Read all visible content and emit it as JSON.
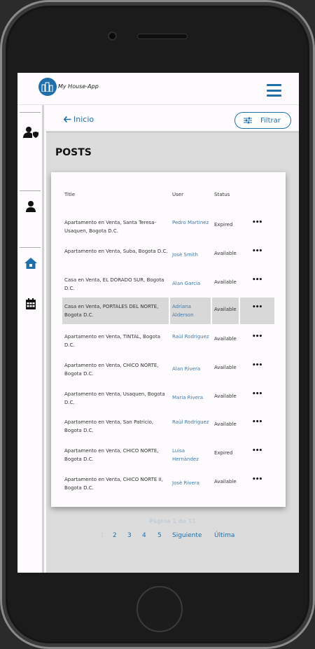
{
  "app": {
    "name": "My House-App"
  },
  "nav": {
    "back_label": "Inicio",
    "filter_label": "Filtrar"
  },
  "page": {
    "title": "POSTS"
  },
  "table": {
    "headers": {
      "title": "Title",
      "user": "User",
      "status": "Status"
    },
    "rows": [
      {
        "title": "Apartamento en Venta, Santa Teresa-Usaquen, Bogota D.C.",
        "user": "Pedro Martinez",
        "status": "Expired",
        "more": "•••"
      },
      {
        "title": "Apartamento en Venta, Suba, Bogota D.C.",
        "user": "Josè Smith",
        "status": "Available",
        "more": "•••"
      },
      {
        "title": "Casa en Venta, EL DORADO SUR, Bogota D.C.",
        "user": "Alan Garcia",
        "status": "Available",
        "more": "•••"
      },
      {
        "title": "Casa en Venta, PORTALES DEL NORTE, Bogota D.C.",
        "user": "Adriana Alderson",
        "status": "Available",
        "more": "•••"
      },
      {
        "title": "Apartamento en Venta, TINTAL, Bogota D.C.",
        "user": "Raùl Rodriguez",
        "status": "Available",
        "more": "•••"
      },
      {
        "title": "Apartamento en Venta, CHICO NORTE, Bogota D.C.",
        "user": "Alan Rivera",
        "status": "Available",
        "more": "•••"
      },
      {
        "title": "Apartamento en Venta, Usaquen, Bogota D.C.",
        "user": "Maria Rivera",
        "status": "Available",
        "more": "•••"
      },
      {
        "title": "Apartamento en Venta, San Patricio, Bogota D.C.",
        "user": "Raùl Rodriguez",
        "status": "Available",
        "more": "•••"
      },
      {
        "title": "Apartamento en Venta, CHICO NORTE, Bogota D.C.",
        "user": "Luisa Hernàndez",
        "status": "Expired",
        "more": "•••"
      },
      {
        "title": "Apartamento en Venta, CHICO NORTE II, Bogota D.C.",
        "user": "Josè Rivera",
        "status": "Available",
        "more": "•••"
      }
    ]
  },
  "pagination": {
    "info": "Pàgina 1 de 11",
    "pages": [
      "1",
      "2",
      "3",
      "4",
      "5"
    ],
    "next_label": "Siguiente",
    "last_label": "Última"
  },
  "colors": {
    "accent": "#1f6fa8",
    "link": "#3d7bb0",
    "highlight": "#d8d8d8"
  }
}
